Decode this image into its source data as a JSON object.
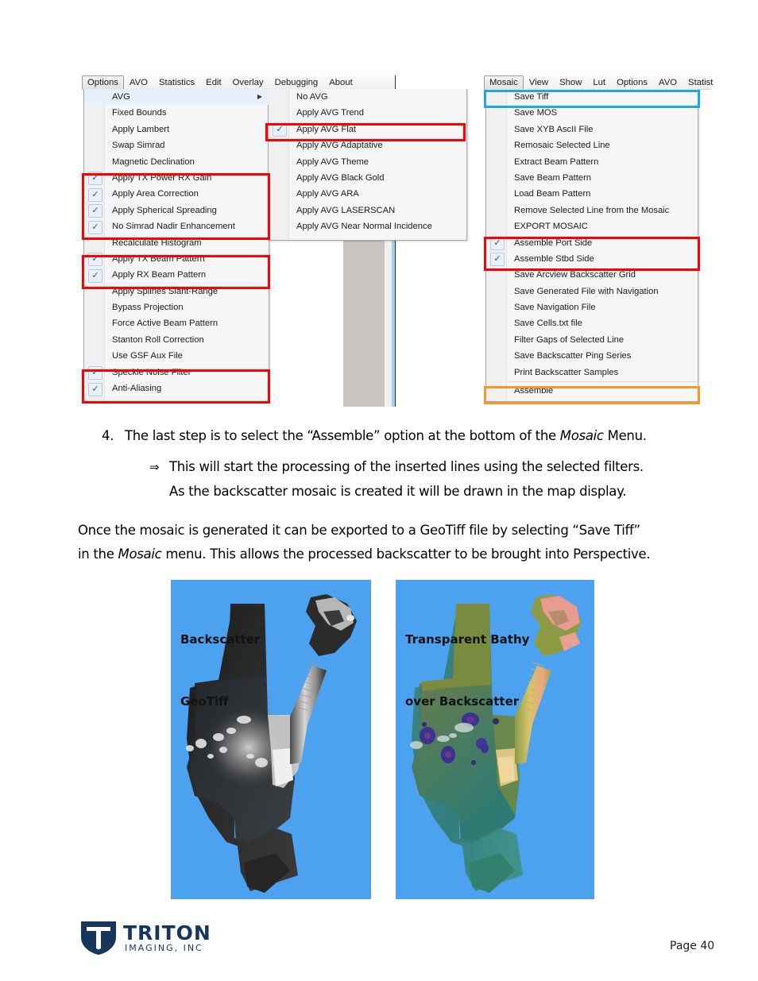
{
  "page": {
    "background": "#ffffff",
    "page_number_label": "Page 40"
  },
  "left_window": {
    "menubar": {
      "items": [
        {
          "label": "Options",
          "selected": true
        },
        {
          "label": "AVO",
          "selected": false
        },
        {
          "label": "Statistics",
          "selected": false
        },
        {
          "label": "Edit",
          "selected": false
        },
        {
          "label": "Overlay",
          "selected": false
        },
        {
          "label": "Debugging",
          "selected": false
        },
        {
          "label": "About",
          "selected": false
        }
      ]
    },
    "options_menu": {
      "items": [
        {
          "label": "AVG",
          "checked": false,
          "submenu": true,
          "highlighted": true
        },
        {
          "label": "Fixed Bounds",
          "checked": false
        },
        {
          "label": "Apply Lambert",
          "checked": false
        },
        {
          "label": "Swap Simrad",
          "checked": false
        },
        {
          "label": "Magnetic Declination",
          "checked": false
        },
        {
          "label": "Apply TX Power RX Gain",
          "checked": true
        },
        {
          "label": "Apply Area Correction",
          "checked": true
        },
        {
          "label": "Apply Spherical Spreading",
          "checked": true
        },
        {
          "label": "No Simrad Nadir Enhancement",
          "checked": true
        },
        {
          "label": "Recalculate Histogram",
          "checked": false
        },
        {
          "label": "Apply TX  Beam Pattern",
          "checked": true
        },
        {
          "label": "Apply RX Beam Pattern",
          "checked": true
        },
        {
          "label": "Apply Splines Slant-Range",
          "checked": false
        },
        {
          "label": "Bypass Projection",
          "checked": false
        },
        {
          "label": "Force Active Beam Pattern",
          "checked": false
        },
        {
          "label": "Stanton Roll Correction",
          "checked": false
        },
        {
          "label": "Use GSF Aux File",
          "checked": false
        },
        {
          "label": "Speckle Noise Filter",
          "checked": true
        },
        {
          "label": "Anti-Aliasing",
          "checked": true
        }
      ]
    },
    "avg_submenu": {
      "items": [
        {
          "label": "No AVG",
          "checked": false
        },
        {
          "label": "Apply AVG Trend",
          "checked": false
        },
        {
          "label": "Apply AVG Flat",
          "checked": true
        },
        {
          "label": "Apply AVG Adaptative",
          "checked": false
        },
        {
          "label": "Apply AVG Theme",
          "checked": false
        },
        {
          "label": "Apply AVG Black Gold",
          "checked": false
        },
        {
          "label": "Apply AVG ARA",
          "checked": false
        },
        {
          "label": "Apply AVG LASERSCAN",
          "checked": false
        },
        {
          "label": "Apply AVG Near Normal Incidence",
          "checked": false
        }
      ]
    }
  },
  "right_window": {
    "menubar": {
      "items": [
        {
          "label": "Mosaic",
          "selected": true
        },
        {
          "label": "View",
          "selected": false
        },
        {
          "label": "Show",
          "selected": false
        },
        {
          "label": "Lut",
          "selected": false
        },
        {
          "label": "Options",
          "selected": false
        },
        {
          "label": "AVO",
          "selected": false
        },
        {
          "label": "Statist",
          "selected": false
        }
      ]
    },
    "mosaic_menu": {
      "items": [
        {
          "label": "Save Tiff",
          "checked": false
        },
        {
          "label": "Save MOS",
          "checked": false
        },
        {
          "label": "Save XYB AscII File",
          "checked": false
        },
        {
          "label": "Remosaic Selected Line",
          "checked": false
        },
        {
          "label": "Extract Beam Pattern",
          "checked": false
        },
        {
          "label": "Save Beam Pattern",
          "checked": false
        },
        {
          "label": "Load Beam Pattern",
          "checked": false
        },
        {
          "label": "Remove Selected Line from the Mosaic",
          "checked": false
        },
        {
          "label": "EXPORT MOSAIC",
          "checked": false
        },
        {
          "label": "Assemble Port Side",
          "checked": true
        },
        {
          "label": "Assemble Stbd Side",
          "checked": true
        },
        {
          "label": "Save Arcview Backscatter Grid",
          "checked": false
        },
        {
          "label": "Save Generated File with Navigation",
          "checked": false
        },
        {
          "label": "Save Navigation File",
          "checked": false
        },
        {
          "label": "Save Cells.txt file",
          "checked": false
        },
        {
          "label": "Filter Gaps of Selected Line",
          "checked": false
        },
        {
          "label": "Save Backscatter Ping Series",
          "checked": false
        },
        {
          "label": "Print Backscatter Samples",
          "checked": false
        },
        {
          "label": "Assemble",
          "checked": false
        }
      ]
    }
  },
  "annotations": {
    "colors": {
      "red": "#ff0000",
      "blue": "#1ca7e8",
      "orange": "#f59824"
    }
  },
  "body": {
    "step_number": "4.",
    "step_text_a": "The last step is to select the “Assemble” option at the bottom of the ",
    "step_text_em": "Mosaic",
    "step_text_b": " Menu.",
    "bullet_glyph": "⇒",
    "bullet_line1": "This will start the processing of the inserted lines using the selected filters.",
    "bullet_line2": "As the backscatter mosaic is created it will be drawn in the map display.",
    "para_line1": "Once the mosaic is generated it can be exported to a GeoTiff file by selecting “Save Tiff”",
    "para_line2_a": "in the ",
    "para_line2_em": "Mosaic",
    "para_line2_b": " menu.  This allows the processed backscatter to be brought into Perspective."
  },
  "figures": [
    {
      "caption_line1": "Backscatter",
      "caption_line2": "GeoTiff",
      "background": "#4da2f0",
      "style": "grayscale-backscatter"
    },
    {
      "caption_line1": "Transparent Bathy",
      "caption_line2": "over Backscatter",
      "background": "#4da2f0",
      "style": "color-bathy"
    }
  ],
  "footer": {
    "brand_name": "TRITON",
    "brand_sub": "IMAGING, INC",
    "brand_color": "#16365c",
    "page_number": "Page 40"
  }
}
